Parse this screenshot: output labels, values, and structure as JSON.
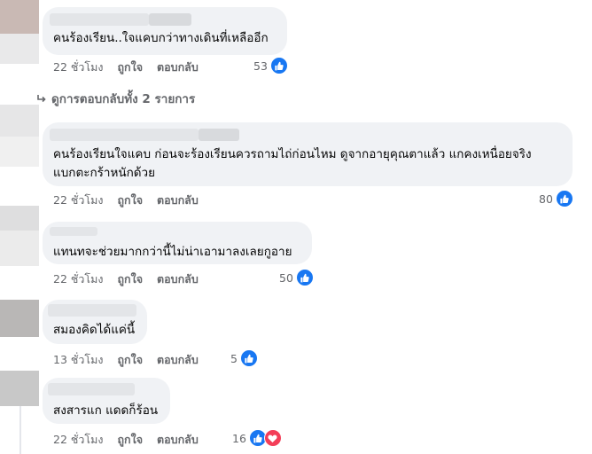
{
  "comments": [
    {
      "text": "คนร้องเรียน..ใจแคบกว่าทางเดินที่เหลืออีก",
      "time": "22 ชั่วโมง",
      "like": "ถูกใจ",
      "reply": "ตอบกลับ",
      "count": "53",
      "reactions": [
        "like-icon"
      ]
    },
    {
      "text": "คนร้องเรียนใจแคบ ก่อนจะร้องเรียนควรถามไถ่ก่อนไหม ดูจากอายุคุณตาแล้ว แกคงเหนื่อยจริง",
      "text2": "แบกตะกร้าหนักด้วย",
      "time": "22 ชั่วโมง",
      "like": "ถูกใจ",
      "reply": "ตอบกลับ",
      "count": "80",
      "reactions": [
        "like-icon"
      ]
    },
    {
      "text": "แทนทจะช่วยมากกว่านี้ไม่น่าเอามาลงเลยกูอาย",
      "time": "22 ชั่วโมง",
      "like": "ถูกใจ",
      "reply": "ตอบกลับ",
      "count": "50",
      "reactions": [
        "like-icon"
      ]
    },
    {
      "text": "สมองคิดได้แค่นี้",
      "time": "13 ชั่วโมง",
      "like": "ถูกใจ",
      "reply": "ตอบกลับ",
      "count": "5",
      "reactions": [
        "like-icon"
      ]
    },
    {
      "text": "สงสารแก แดดก็ร้อน",
      "time": "22 ชั่วโมง",
      "like": "ถูกใจ",
      "reply": "ตอบกลับ",
      "count": "16",
      "reactions": [
        "like-icon",
        "love-icon"
      ]
    }
  ],
  "view_replies": {
    "label": "ดูการตอบกลับทั้ง 2 รายการ"
  },
  "colors": {
    "like": "#1877f2",
    "love": "#f33e58",
    "bubble": "#f0f2f5",
    "meta": "#65676b"
  }
}
